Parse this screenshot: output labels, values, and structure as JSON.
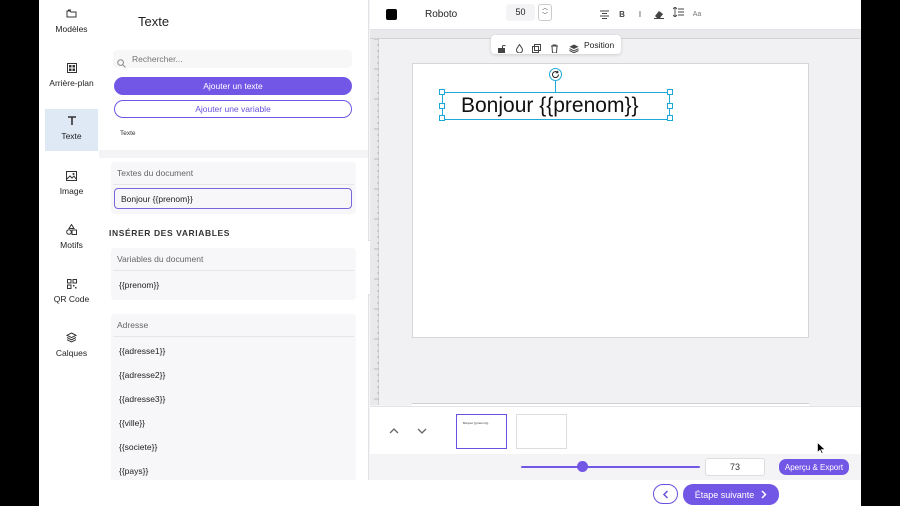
{
  "rail": {
    "items": [
      {
        "label": "Modèles",
        "icon": "folder-icon"
      },
      {
        "label": "Arrière-plan",
        "icon": "grid-icon"
      },
      {
        "label": "Texte",
        "icon": "text-icon"
      },
      {
        "label": "Image",
        "icon": "image-icon"
      },
      {
        "label": "Motifs",
        "icon": "shapes-icon"
      },
      {
        "label": "QR Code",
        "icon": "qr-code-icon"
      },
      {
        "label": "Calques",
        "icon": "layers-icon"
      }
    ]
  },
  "panel": {
    "title": "Texte",
    "search_placeholder": "Rechercher...",
    "add_text_label": "Ajouter un texte",
    "add_variable_label": "Ajouter une variable",
    "small_text": "Texte",
    "doc_texts_head": "Textes du document",
    "doc_text_value": "Bonjour {{prenom}}",
    "insert_head": "INSÉRER DES VARIABLES",
    "doc_vars_head": "Variables du document",
    "doc_vars": [
      "{{prenom}}"
    ],
    "address_head": "Adresse",
    "address_vars": [
      "{{adresse1}}",
      "{{adresse2}}",
      "{{adresse3}}",
      "{{ville}}",
      "{{societe}}",
      "{{pays}}"
    ]
  },
  "toolbar": {
    "color": "#000000",
    "font_name": "Roboto",
    "font_size": "50",
    "bold": "B",
    "italic": "I",
    "case": "Aa"
  },
  "float_toolbar": {
    "position_label": "Position"
  },
  "canvas": {
    "text": "Bonjour {{prenom}}",
    "selection_color": "#1ea8d8"
  },
  "thumbs": {
    "mini_text": "Bonjour {{prenom}}"
  },
  "bottom": {
    "zoom_value": "73",
    "zoom_fraction": 0.34,
    "export_label": "Aperçu & Export"
  },
  "footer": {
    "next_label": "Étape suivante"
  },
  "colors": {
    "accent": "#7257e6",
    "rail_active": "#dfe9f5"
  }
}
